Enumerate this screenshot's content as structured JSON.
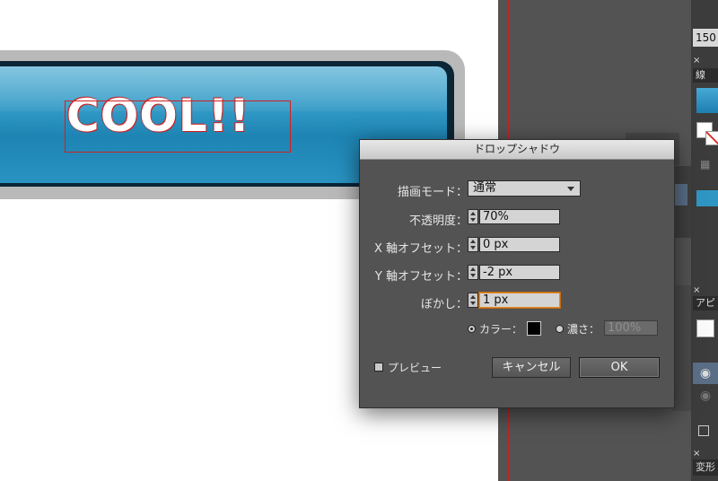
{
  "canvas": {
    "button_text": "COOL!!",
    "button_color": "#2f97c4"
  },
  "side_panel": {
    "zoom_value": "150",
    "close_glyph": "×",
    "tab1_label": "線",
    "tab2_label": "アピ",
    "tab3_label": "変形"
  },
  "dialog": {
    "title": "ドロップシャドウ",
    "mode": {
      "label": "描画モード：",
      "value": "通常"
    },
    "opacity": {
      "label": "不透明度：",
      "value": "70%"
    },
    "x_offset": {
      "label": "X 軸オフセット：",
      "value": "0 px"
    },
    "y_offset": {
      "label": "Y 軸オフセット：",
      "value": "-2 px"
    },
    "blur": {
      "label": "ぼかし：",
      "value": "1 px"
    },
    "color_option": {
      "label": "カラー：",
      "selected": true,
      "swatch": "#000000"
    },
    "darkness_option": {
      "label": "濃さ：",
      "value": "100%",
      "selected": false
    },
    "preview": {
      "label": "プレビュー",
      "checked": false
    },
    "cancel_label": "キャンセル",
    "ok_label": "OK"
  }
}
